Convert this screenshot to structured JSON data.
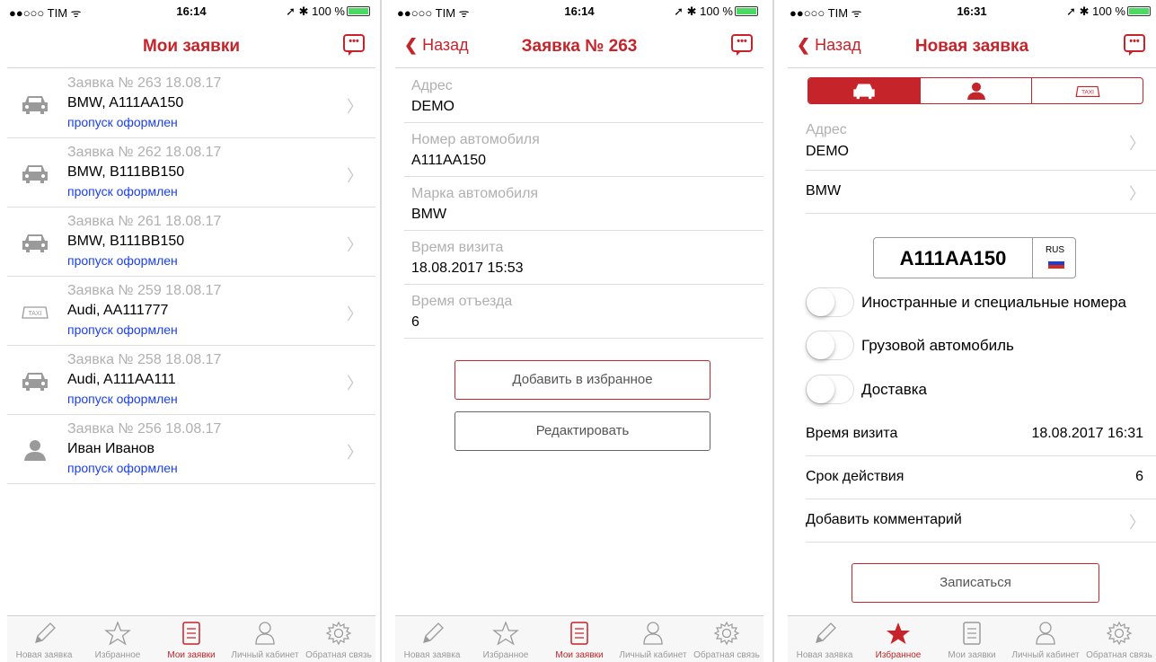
{
  "status": {
    "carrier": "●●○○○ TIM ᯤ",
    "s1_time": "16:14",
    "s2_time": "16:14",
    "s3_time": "16:31",
    "battery": "100 %",
    "arrow": "➚ ✱"
  },
  "screen1": {
    "title": "Мои заявки",
    "rows": [
      {
        "head": "Заявка № 263 18.08.17",
        "main": "BMW, A111AA150",
        "status": "пропуск оформлен",
        "icon": "car-icon"
      },
      {
        "head": "Заявка № 262 18.08.17",
        "main": "BMW, B111BB150",
        "status": "пропуск оформлен",
        "icon": "car-icon"
      },
      {
        "head": "Заявка № 261 18.08.17",
        "main": "BMW, B111BB150",
        "status": "пропуск оформлен",
        "icon": "car-icon"
      },
      {
        "head": "Заявка № 259 18.08.17",
        "main": "Audi, AA111777",
        "status": "пропуск оформлен",
        "icon": "taxi-icon"
      },
      {
        "head": "Заявка № 258 18.08.17",
        "main": "Audi, A111AA111",
        "status": "пропуск оформлен",
        "icon": "car-icon"
      },
      {
        "head": "Заявка № 256 18.08.17",
        "main": "Иван Иванов",
        "status": "пропуск оформлен",
        "icon": "person-icon"
      }
    ]
  },
  "screen2": {
    "back": "Назад",
    "title": "Заявка № 263",
    "fields": [
      {
        "label": "Адрес",
        "value": "DEMO"
      },
      {
        "label": "Номер автомобиля",
        "value": "A111AA150"
      },
      {
        "label": "Марка автомобиля",
        "value": "BMW"
      },
      {
        "label": "Время визита",
        "value": "18.08.2017 15:53"
      },
      {
        "label": "Время отъезда",
        "value": "6"
      }
    ],
    "btn_fav": "Добавить в избранное",
    "btn_edit": "Редактировать"
  },
  "screen3": {
    "back": "Назад",
    "title": "Новая заявка",
    "segments": [
      "car-icon",
      "person-icon",
      "taxi-icon"
    ],
    "selected_segment": 0,
    "taxi": "TAXI",
    "address_label": "Адрес",
    "address_value": "DEMO",
    "brand": "BMW",
    "plate": "A111AA150",
    "region": "RUS",
    "toggles": [
      {
        "label": "Иностранные и специальные номера",
        "on": false
      },
      {
        "label": "Грузовой автомобиль",
        "on": false
      },
      {
        "label": "Доставка",
        "on": false
      }
    ],
    "visit_label": "Время визита",
    "visit_value": "18.08.2017 16:31",
    "term_label": "Срок действия",
    "term_value": "6",
    "comment_label": "Добавить комментарий",
    "submit": "Записаться"
  },
  "tabs": [
    "Новая заявка",
    "Избранное",
    "Мои заявки",
    "Личный кабинет",
    "Обратная связь"
  ],
  "tabbar_active": {
    "s1": 2,
    "s2": 2,
    "s3": 1
  },
  "colors": {
    "accent": "#c4242a",
    "link": "#1a3ff0",
    "muted": "#b0b0b0"
  }
}
